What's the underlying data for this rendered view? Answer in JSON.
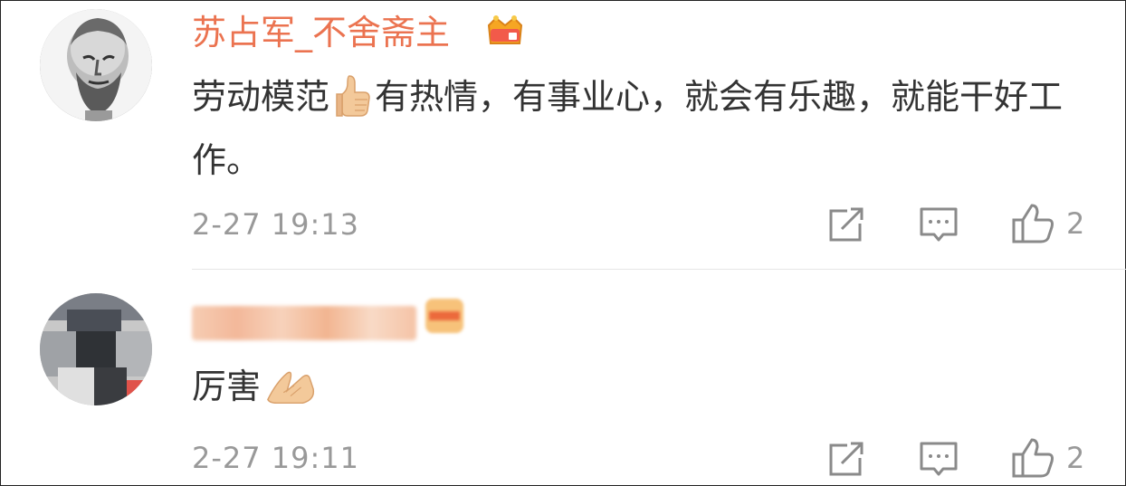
{
  "comments": [
    {
      "username": "苏占军_不舍斋主",
      "badge_icon": "crown-badge-icon",
      "text_before_emoji": "劳动模范",
      "emoji": "thumbs-up-emoji",
      "text_after_emoji": "有热情，有事业心，就会有乐趣，就能干好工作。",
      "time": "2-27 19:13",
      "like_count": "2"
    },
    {
      "username": "",
      "username_blurred": true,
      "badge_icon": "member-badge-icon",
      "text_before_emoji": "厉害",
      "emoji": "praying-hands-emoji",
      "text_after_emoji": "",
      "time": "2-27 19:11",
      "like_count": "2"
    }
  ],
  "colors": {
    "username": "#eb7350",
    "body_text": "#333333",
    "meta_text": "#999999",
    "icon_stroke": "#8a8a8a"
  }
}
